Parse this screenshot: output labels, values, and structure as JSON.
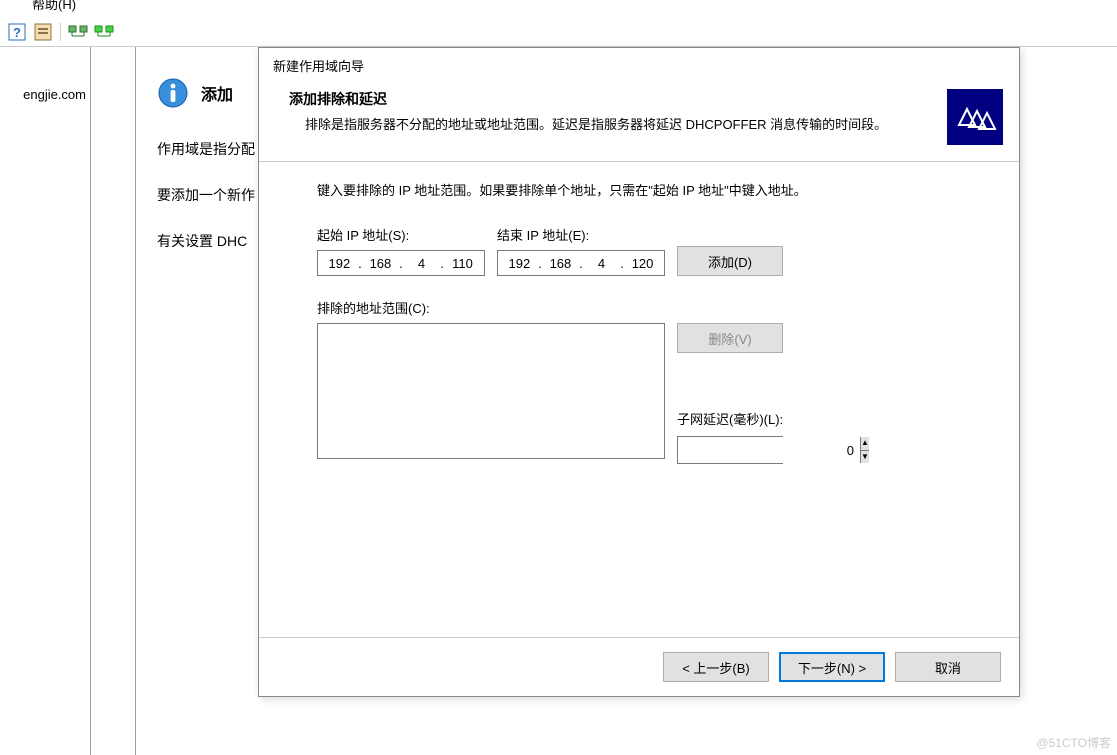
{
  "menubar": {
    "help": "帮助(H)"
  },
  "toolbar": {
    "help_icon": "help-icon",
    "properties_icon": "properties-icon",
    "server1_icon": "server-icon",
    "server2_icon": "server-green-icon"
  },
  "left_pane": {
    "domain_text": "engjie.com"
  },
  "content": {
    "heading_prefix": "添加",
    "line1": "作用域是指分配",
    "line2": "要添加一个新作",
    "line3": "有关设置 DHC"
  },
  "dialog": {
    "title": "新建作用域向导",
    "header_title": "添加排除和延迟",
    "header_desc": "排除是指服务器不分配的地址或地址范围。延迟是指服务器将延迟 DHCPOFFER 消息传输的时间段。",
    "instruction": "键入要排除的 IP 地址范围。如果要排除单个地址，只需在\"起始 IP 地址\"中键入地址。",
    "start_ip_label": "起始 IP 地址(S):",
    "end_ip_label": "结束 IP 地址(E):",
    "start_ip": {
      "o1": "192",
      "o2": "168",
      "o3": "4",
      "o4": "110"
    },
    "end_ip": {
      "o1": "192",
      "o2": "168",
      "o3": "4",
      "o4": "120"
    },
    "add_btn": "添加(D)",
    "excluded_label": "排除的地址范围(C):",
    "remove_btn": "删除(V)",
    "delay_label": "子网延迟(毫秒)(L):",
    "delay_value": "0",
    "back_btn": "< 上一步(B)",
    "next_btn": "下一步(N) >",
    "cancel_btn": "取消"
  },
  "watermark": "@51CTO博客"
}
